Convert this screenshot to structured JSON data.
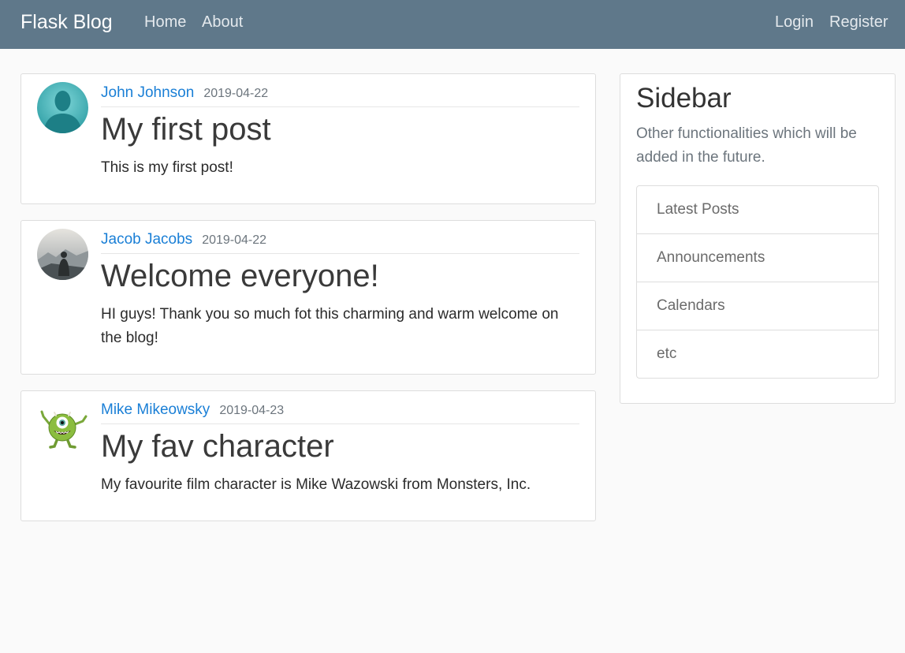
{
  "navbar": {
    "brand": "Flask Blog",
    "links_left": [
      "Home",
      "About"
    ],
    "links_right": [
      "Login",
      "Register"
    ]
  },
  "posts": [
    {
      "author": "John Johnson",
      "date": "2019-04-22",
      "title": "My first post",
      "content": "This is my first post!",
      "avatar_icon": "default-user-avatar"
    },
    {
      "author": "Jacob Jacobs",
      "date": "2019-04-22",
      "title": "Welcome everyone!",
      "content": "HI guys! Thank you so much fot this charming and warm welcome on the blog!",
      "avatar_icon": "misty-landscape-avatar"
    },
    {
      "author": "Mike Mikeowsky",
      "date": "2019-04-23",
      "title": "My fav character",
      "content": "My favourite film character is Mike Wazowski from Monsters, Inc.",
      "avatar_icon": "green-monster-avatar"
    }
  ],
  "sidebar": {
    "title": "Sidebar",
    "text": "Other functionalities which will be added in the future.",
    "items": [
      "Latest Posts",
      "Announcements",
      "Calendars",
      "etc"
    ]
  },
  "colors": {
    "navbar_bg": "#5f788a",
    "link": "#1a7fd6",
    "page_bg": "#fafafa"
  }
}
